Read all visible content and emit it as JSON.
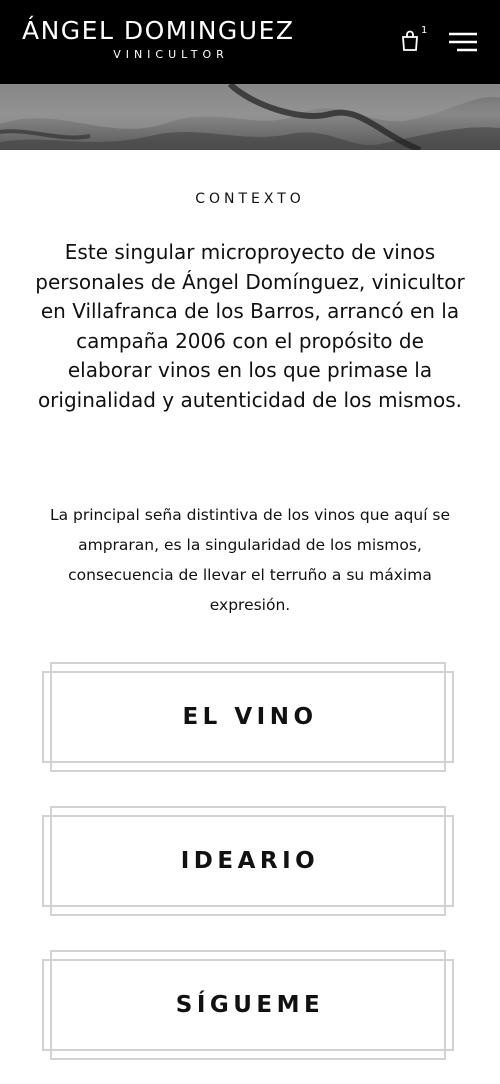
{
  "header": {
    "brand_title": "ÁNGEL DOMINGUEZ",
    "brand_subtitle": "VINICULTOR",
    "cart_count": "1",
    "background": "#000000",
    "text_color": "#ffffff",
    "icons": {
      "cart": "shopping-bag-icon",
      "menu": "hamburger-menu-icon"
    }
  },
  "hero": {
    "description": "grayscale-photo-strip"
  },
  "main": {
    "eyebrow": "CONTEXTO",
    "lead": "Este singular microproyecto de vinos personales de Ángel Domínguez, vinicultor en Villafranca de los Barros, arrancó en la campaña 2006 con el propósito de elaborar vinos en los que primase la originalidad y autenticidad de los mismos.",
    "body": "La principal seña distintiva de los vinos que aquí se ampraran, es la singularidad de los mismos, consecuencia de llevar el terruño a su máxima expresión."
  },
  "nav_links": [
    {
      "label": "EL VINO"
    },
    {
      "label": "IDEARIO"
    },
    {
      "label": "SÍGUEME"
    }
  ],
  "colors": {
    "frame_border": "#d2d2d2",
    "text": "#111111"
  }
}
